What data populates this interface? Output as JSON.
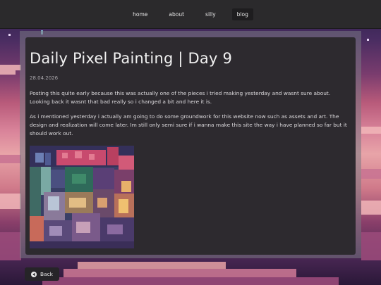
{
  "nav": {
    "items": [
      {
        "label": "home"
      },
      {
        "label": "about"
      },
      {
        "label": "silly"
      },
      {
        "label": "blog"
      }
    ],
    "active": "blog"
  },
  "post": {
    "title": "Daily Pixel Painting | Day 9",
    "date": "28.04.2026",
    "paragraphs": [
      "Posting this quite early because this was actually one of the pieces i tried making yesterday and wasnt sure about. Looking back it wasnt that bad really so i changed a bit and here it is.",
      "As i mentioned yesterday i actually am going to do some groundwork for this website now such as assets and art. The design and realization will come later. Im still only semi sure if i wanna make this site the way i have planned so far but it should work out."
    ]
  },
  "back": {
    "label": "Back",
    "icon": "arrow-left-circle-icon"
  },
  "colors": {
    "navbar": "#2b2a2c",
    "panel": "#2d2a2f",
    "text": "#dedcdf",
    "sky_pink": "#e8a4a8",
    "sky_purple": "#4a2d62"
  }
}
